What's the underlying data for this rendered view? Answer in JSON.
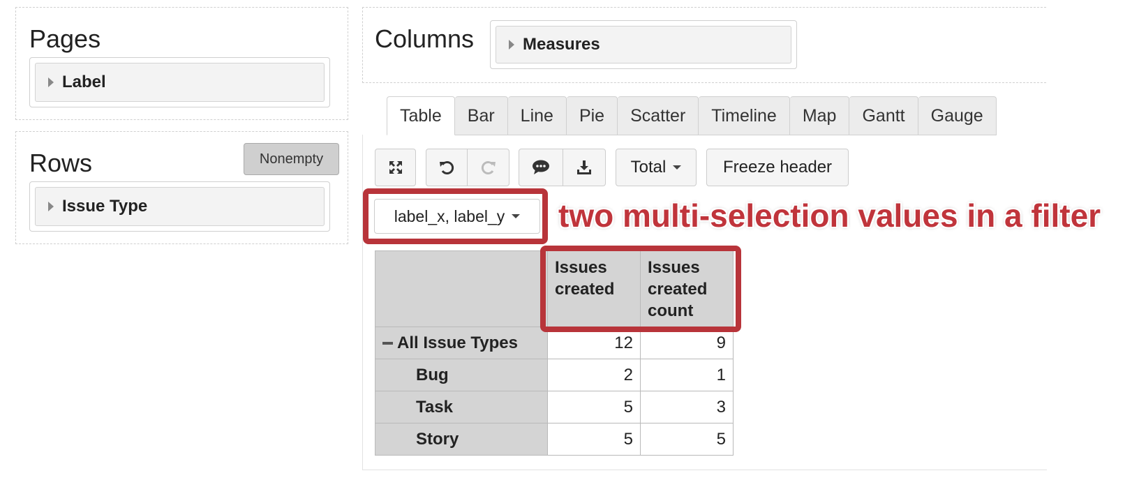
{
  "pages": {
    "title": "Pages",
    "items": [
      "Label"
    ]
  },
  "rows": {
    "title": "Rows",
    "nonempty_label": "Nonempty",
    "items": [
      "Issue Type"
    ]
  },
  "columns": {
    "title": "Columns",
    "items": [
      "Measures"
    ]
  },
  "tabs": [
    "Table",
    "Bar",
    "Line",
    "Pie",
    "Scatter",
    "Timeline",
    "Map",
    "Gantt",
    "Gauge"
  ],
  "active_tab": "Table",
  "toolbar": {
    "icons": [
      "expand-icon",
      "undo-icon",
      "redo-icon",
      "comment-icon",
      "download-icon"
    ],
    "total_label": "Total",
    "freeze_label": "Freeze header"
  },
  "filter": {
    "value": "label_x, label_y"
  },
  "annotation": "two multi-selection values in a filter",
  "accent_color": "#b8343a",
  "table": {
    "columns": [
      "Issues created",
      "Issues created count"
    ],
    "rows": [
      {
        "label": "All Issue Types",
        "values": [
          "12",
          "9"
        ]
      },
      {
        "label": "Bug",
        "values": [
          "2",
          "1"
        ]
      },
      {
        "label": "Task",
        "values": [
          "5",
          "3"
        ]
      },
      {
        "label": "Story",
        "values": [
          "5",
          "5"
        ]
      }
    ]
  }
}
